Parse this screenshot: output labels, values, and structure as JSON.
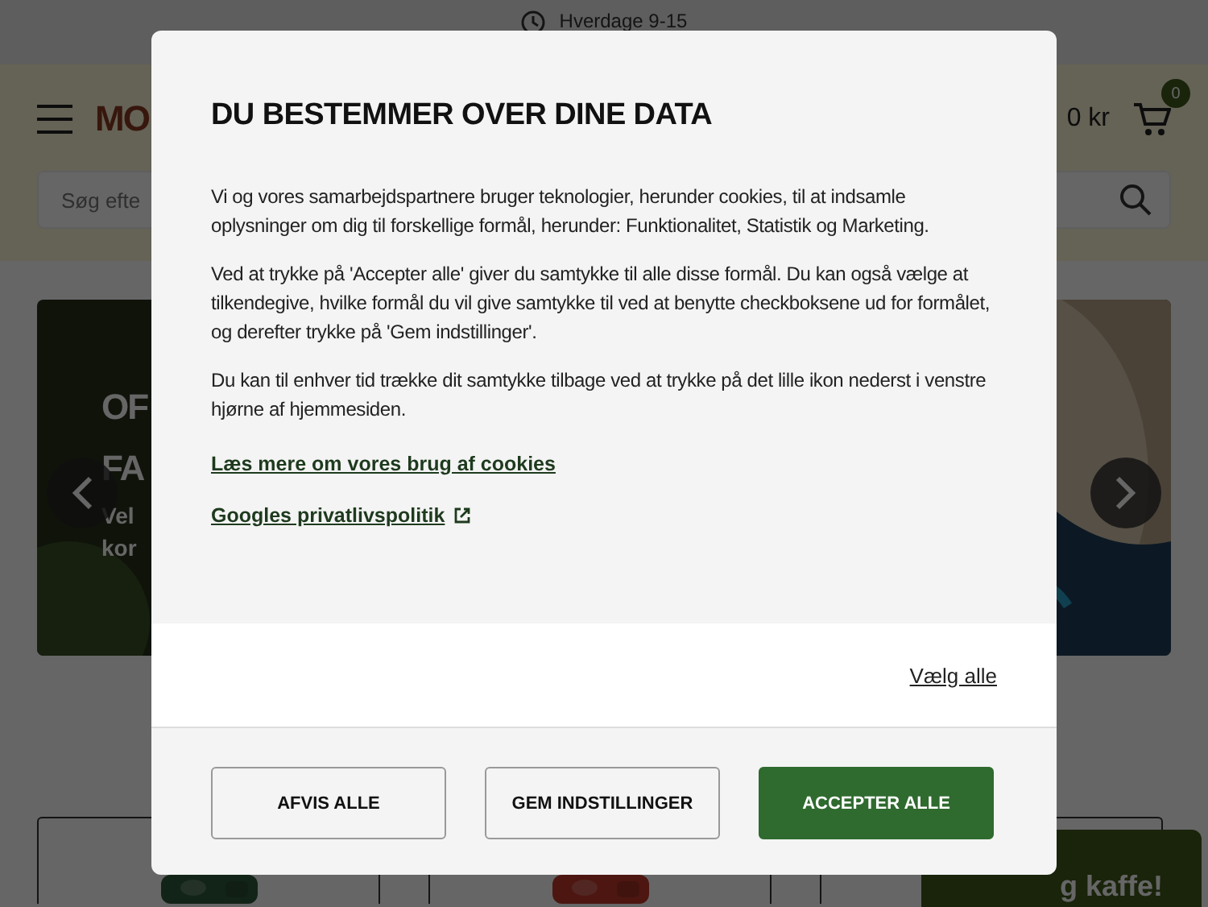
{
  "topbar": {
    "text": "Hverdage 9-15"
  },
  "header": {
    "logo": "MO",
    "cart_total": "0 kr",
    "cart_count": "0",
    "search": {
      "placeholder": "Søg efte"
    }
  },
  "hero": {
    "title_lines": [
      "OF",
      "FA"
    ],
    "subtitle_lines": [
      "Vel",
      "kor"
    ]
  },
  "chat_button": {
    "label": "g kaffe!"
  },
  "consent": {
    "title": "DU BESTEMMER OVER DINE DATA",
    "paragraphs": [
      "Vi og vores samarbejdspartnere bruger teknologier, herunder cookies, til at indsamle oplysninger om dig til forskellige formål, herunder: Funktionalitet, Statistik og Marketing.",
      "Ved at trykke på 'Accepter alle' giver du samtykke til alle disse formål. Du kan også vælge at tilkendegive, hvilke formål du vil give samtykke til ved at benytte checkboksene ud for formålet, og derefter trykke på 'Gem indstillinger'.",
      "Du kan til enhver tid trække dit samtykke tilbage ved at trykke på det lille ikon nederst i venstre hjørne af hjemmesiden."
    ],
    "links": [
      {
        "text": "Læs mere om vores brug af cookies",
        "external": false
      },
      {
        "text": "Googles privatlivspolitik",
        "external": true
      }
    ],
    "select_all": "Vælg alle",
    "buttons": [
      {
        "label": "AFVIS ALLE",
        "kind": "secondary"
      },
      {
        "label": "GEM INDSTILLINGER",
        "kind": "secondary"
      },
      {
        "label": "ACCEPTER ALLE",
        "kind": "primary"
      }
    ]
  }
}
